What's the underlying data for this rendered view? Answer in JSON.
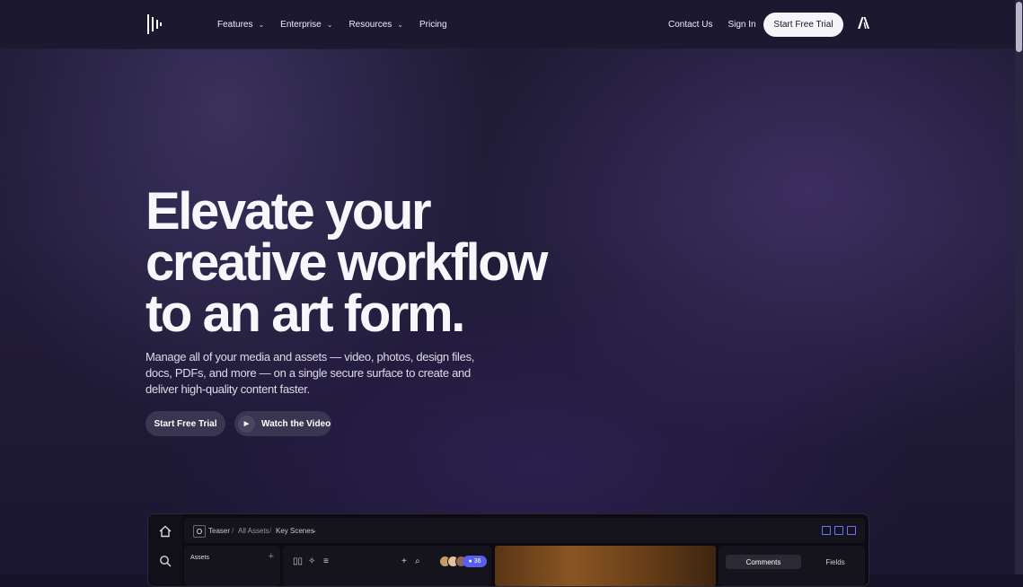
{
  "nav": {
    "items": [
      {
        "label": "Features",
        "has_menu": true
      },
      {
        "label": "Enterprise",
        "has_menu": true
      },
      {
        "label": "Resources",
        "has_menu": true
      },
      {
        "label": "Pricing",
        "has_menu": false
      }
    ],
    "contact_label": "Contact Us",
    "signin_label": "Sign In",
    "trial_label": "Start Free Trial"
  },
  "hero": {
    "title_lines": [
      "Elevate your",
      "creative workflow",
      "to an art form."
    ],
    "subtitle": "Manage all of your media and assets — video, photos, design files, docs, PDFs, and more — on a single secure surface to create and deliver high-quality content faster.",
    "primary_cta": "Start Free Trial",
    "secondary_cta": "Watch the Video"
  },
  "app_preview": {
    "project_initial": "O",
    "breadcrumb": [
      "Teaser",
      "All Assets",
      "Key Scenes"
    ],
    "assets_label": "Assets",
    "collaborator_count": "36",
    "tabs": [
      "Comments",
      "Fields"
    ]
  },
  "colors": {
    "accent": "#5a5ff0",
    "background": "#1e1a33",
    "button": "#3a3550"
  }
}
